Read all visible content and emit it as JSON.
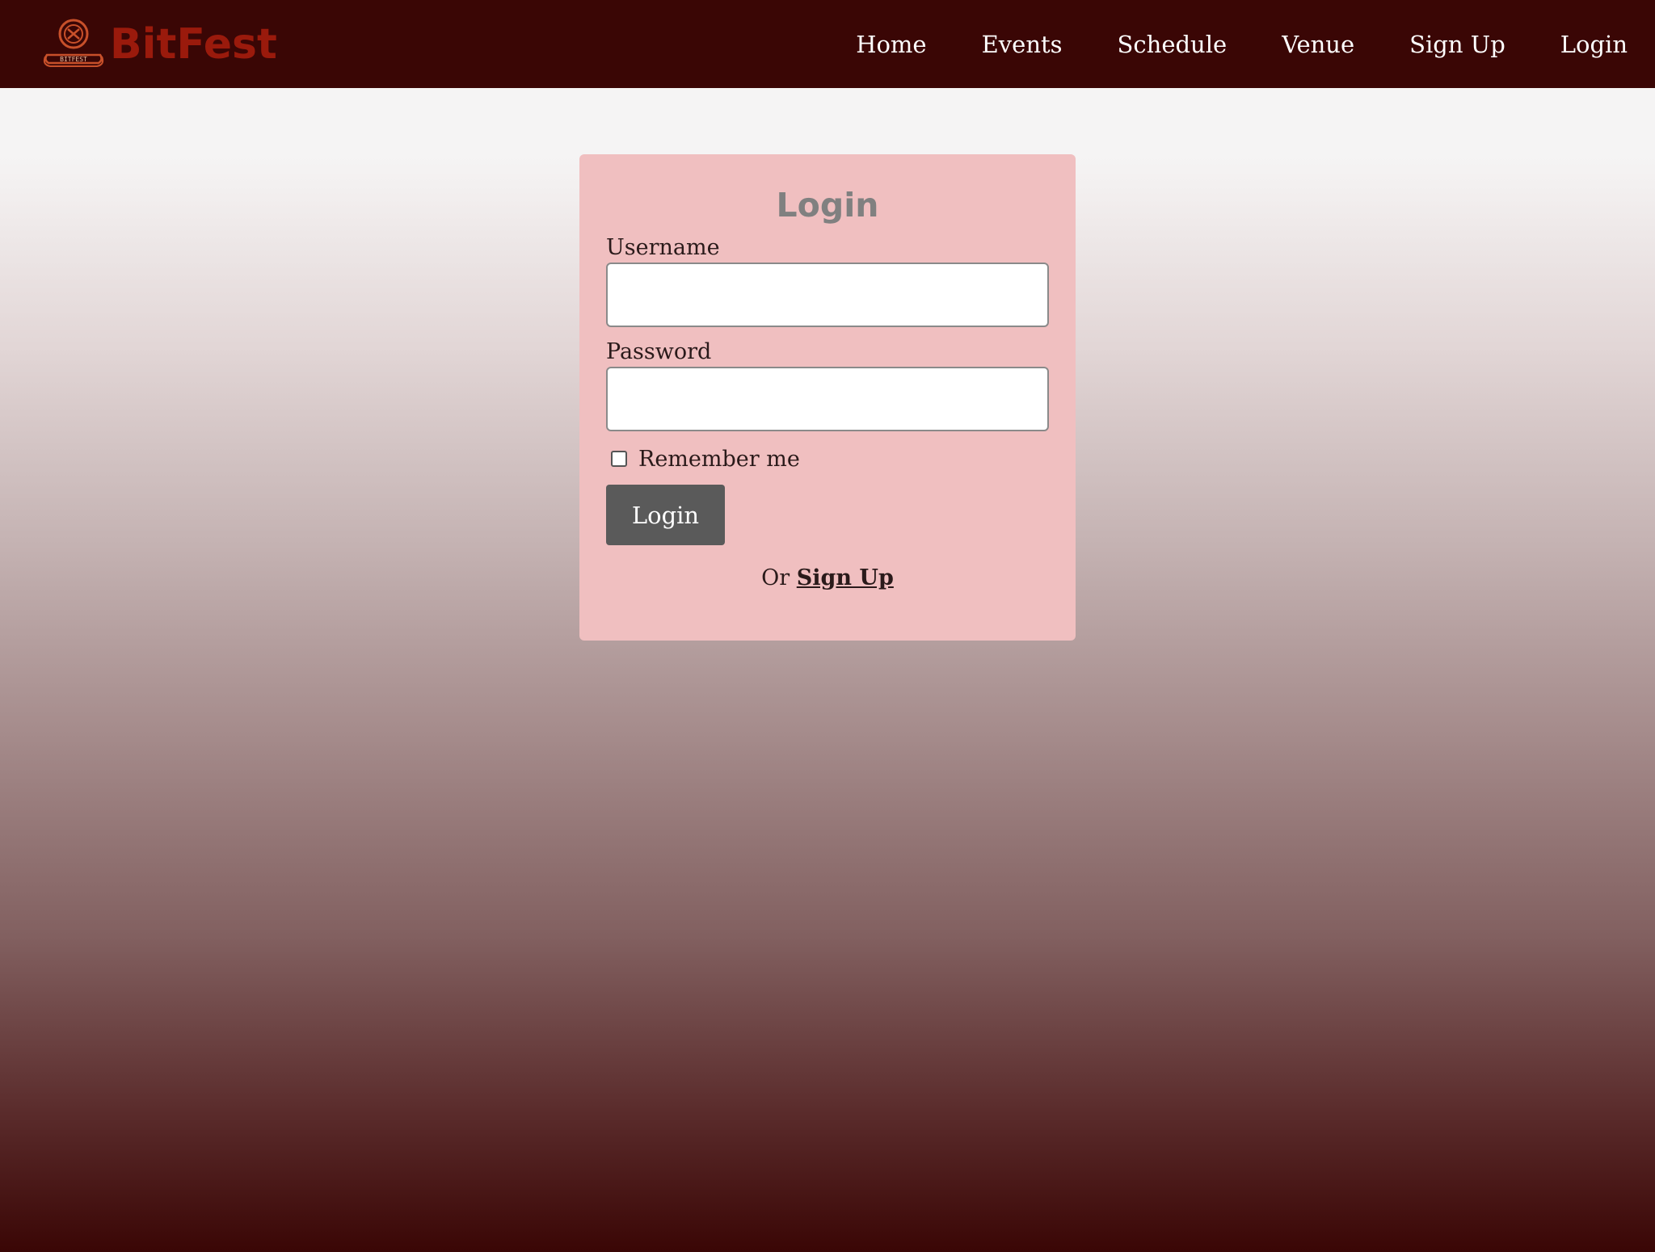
{
  "brand": {
    "name": "BitFest",
    "logo_icon": "bitfest-logo-icon",
    "logo_text": "BITFEST"
  },
  "nav": {
    "items": [
      {
        "label": "Home"
      },
      {
        "label": "Events"
      },
      {
        "label": "Schedule"
      },
      {
        "label": "Venue"
      },
      {
        "label": "Sign Up"
      },
      {
        "label": "Login"
      }
    ]
  },
  "login_form": {
    "title": "Login",
    "username_label": "Username",
    "username_value": "",
    "password_label": "Password",
    "password_value": "",
    "remember_label": "Remember me",
    "remember_checked": false,
    "submit_label": "Login",
    "alt_prefix": "Or",
    "alt_link_label": "Sign Up"
  },
  "colors": {
    "navbar": "#3a0605",
    "brand": "#9a1a0c",
    "card": "#f0bfc0",
    "button": "#5a5a5a",
    "title": "#808080"
  }
}
